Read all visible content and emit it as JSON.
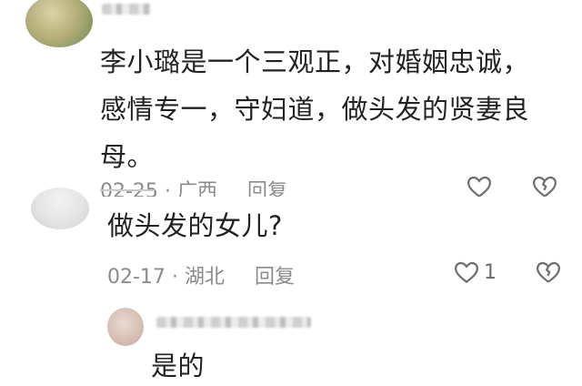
{
  "comments": [
    {
      "text_lines": [
        "李小璐是一个三观正，对婚姻忠诚，",
        "感情专一，守妇道，做头发的贤妻良",
        "母。"
      ],
      "date": "02-25",
      "location": "广西",
      "reply_label": "回复",
      "like_count": ""
    },
    {
      "text": "做头发的女儿?",
      "date": "02-17",
      "location": "湖北",
      "reply_label": "回复",
      "like_count": "1"
    },
    {
      "text": "是的"
    }
  ],
  "separator": "·",
  "icons": {
    "like": "heart-outline-icon",
    "dislike": "broken-heart-icon"
  }
}
